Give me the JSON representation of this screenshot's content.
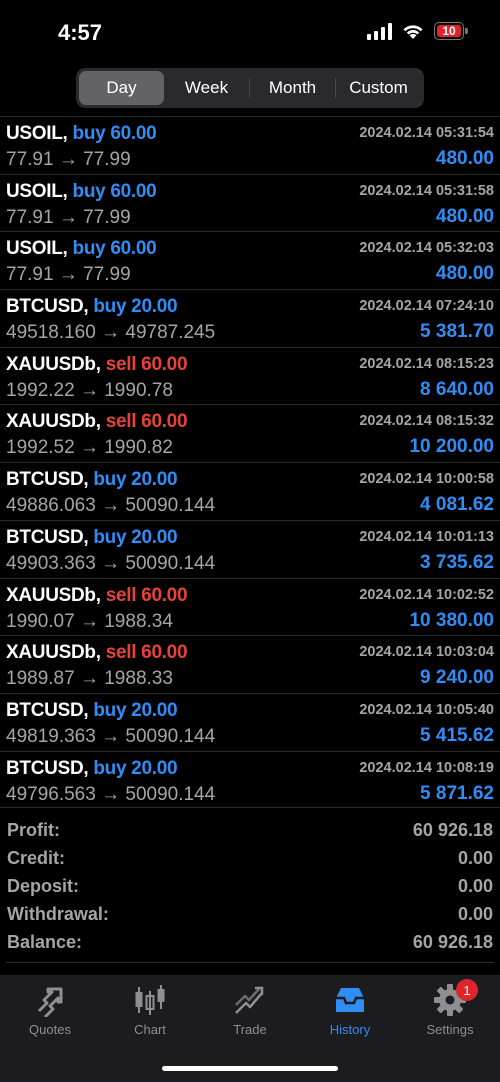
{
  "status": {
    "time": "4:57",
    "battery": "10"
  },
  "segments": [
    {
      "label": "Day",
      "active": true
    },
    {
      "label": "Week",
      "active": false
    },
    {
      "label": "Month",
      "active": false
    },
    {
      "label": "Custom",
      "active": false
    }
  ],
  "trades": [
    {
      "symbol": "USOIL,",
      "side": "buy 60.00",
      "type": "buy",
      "prices": "77.91 → 77.99",
      "time": "2024.02.14 05:31:54",
      "profit": "480.00"
    },
    {
      "symbol": "USOIL,",
      "side": "buy 60.00",
      "type": "buy",
      "prices": "77.91 → 77.99",
      "time": "2024.02.14 05:31:58",
      "profit": "480.00"
    },
    {
      "symbol": "USOIL,",
      "side": "buy 60.00",
      "type": "buy",
      "prices": "77.91 → 77.99",
      "time": "2024.02.14 05:32:03",
      "profit": "480.00"
    },
    {
      "symbol": "BTCUSD,",
      "side": "buy 20.00",
      "type": "buy",
      "prices": "49518.160 → 49787.245",
      "time": "2024.02.14 07:24:10",
      "profit": "5 381.70"
    },
    {
      "symbol": "XAUUSDb,",
      "side": "sell 60.00",
      "type": "sell",
      "prices": "1992.22 → 1990.78",
      "time": "2024.02.14 08:15:23",
      "profit": "8 640.00"
    },
    {
      "symbol": "XAUUSDb,",
      "side": "sell 60.00",
      "type": "sell",
      "prices": "1992.52 → 1990.82",
      "time": "2024.02.14 08:15:32",
      "profit": "10 200.00"
    },
    {
      "symbol": "BTCUSD,",
      "side": "buy 20.00",
      "type": "buy",
      "prices": "49886.063 → 50090.144",
      "time": "2024.02.14 10:00:58",
      "profit": "4 081.62"
    },
    {
      "symbol": "BTCUSD,",
      "side": "buy 20.00",
      "type": "buy",
      "prices": "49903.363 → 50090.144",
      "time": "2024.02.14 10:01:13",
      "profit": "3 735.62"
    },
    {
      "symbol": "XAUUSDb,",
      "side": "sell 60.00",
      "type": "sell",
      "prices": "1990.07 → 1988.34",
      "time": "2024.02.14 10:02:52",
      "profit": "10 380.00"
    },
    {
      "symbol": "XAUUSDb,",
      "side": "sell 60.00",
      "type": "sell",
      "prices": "1989.87 → 1988.33",
      "time": "2024.02.14 10:03:04",
      "profit": "9 240.00"
    },
    {
      "symbol": "BTCUSD,",
      "side": "buy 20.00",
      "type": "buy",
      "prices": "49819.363 → 50090.144",
      "time": "2024.02.14 10:05:40",
      "profit": "5 415.62"
    },
    {
      "symbol": "BTCUSD,",
      "side": "buy 20.00",
      "type": "buy",
      "prices": "49796.563 → 50090.144",
      "time": "2024.02.14 10:08:19",
      "profit": "5 871.62"
    }
  ],
  "summary": [
    {
      "label": "Profit:",
      "value": "60 926.18"
    },
    {
      "label": "Credit:",
      "value": "0.00"
    },
    {
      "label": "Deposit:",
      "value": "0.00"
    },
    {
      "label": "Withdrawal:",
      "value": "0.00"
    },
    {
      "label": "Balance:",
      "value": "60 926.18"
    }
  ],
  "tabs": [
    {
      "label": "Quotes",
      "icon": "quotes-icon",
      "active": false
    },
    {
      "label": "Chart",
      "icon": "candlestick-icon",
      "active": false
    },
    {
      "label": "Trade",
      "icon": "trade-icon",
      "active": false
    },
    {
      "label": "History",
      "icon": "history-inbox-icon",
      "active": true
    },
    {
      "label": "Settings",
      "icon": "gear-icon",
      "active": false,
      "badge": "1"
    }
  ],
  "colors": {
    "buy": "#2f8df5",
    "sell": "#e84238",
    "accent": "#2f8df5",
    "muted": "#a5a5a5"
  }
}
